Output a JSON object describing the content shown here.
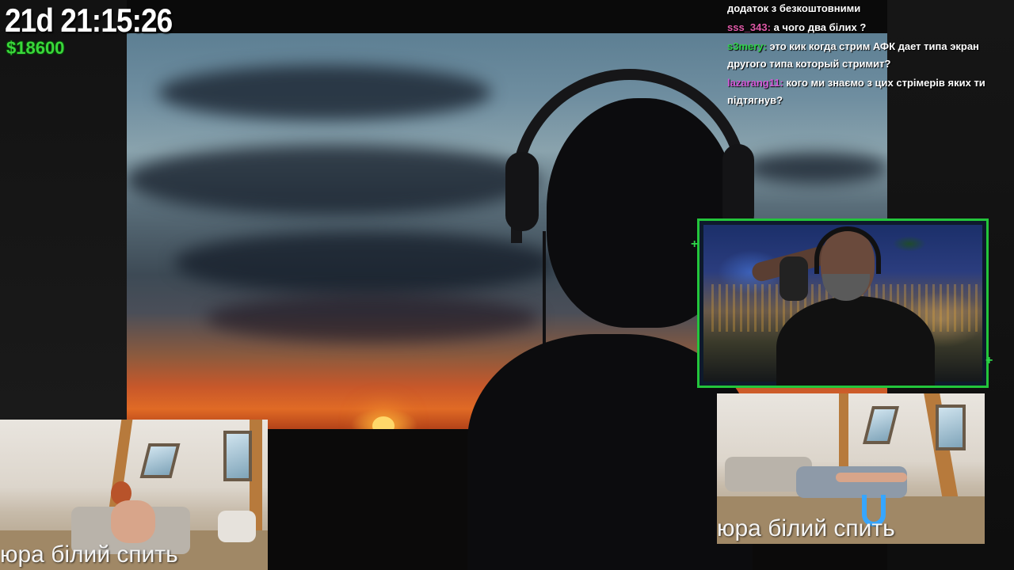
{
  "overlay": {
    "timer": "21d 21:15:26",
    "money": "$18600"
  },
  "chat": {
    "messages": [
      {
        "user": "",
        "user_color": "#ffffff",
        "text": "додаток з безкоштовними"
      },
      {
        "user": "sss_343",
        "user_color": "#e05aa8",
        "text": "а чого два білих ?"
      },
      {
        "user": "s3mery",
        "user_color": "#2fd44a",
        "text": "это кик когда стрим АФК дает типа экран другого типа который стримит?"
      },
      {
        "user": "lazarang11",
        "user_color": "#d35ad8",
        "text": "кого ми знаємо з цих стрімерів яких ти підтягнув?"
      }
    ]
  },
  "cams": {
    "left_caption": "юра білий  спить",
    "right_caption": "юра білий  спить"
  },
  "colors": {
    "webcam_border": "#23c53b",
    "money": "#39d83a",
    "logo": "#37a6ff"
  },
  "icons": {
    "stream_logo": "letter-u-logo",
    "frame_handle": "plus-icon"
  }
}
